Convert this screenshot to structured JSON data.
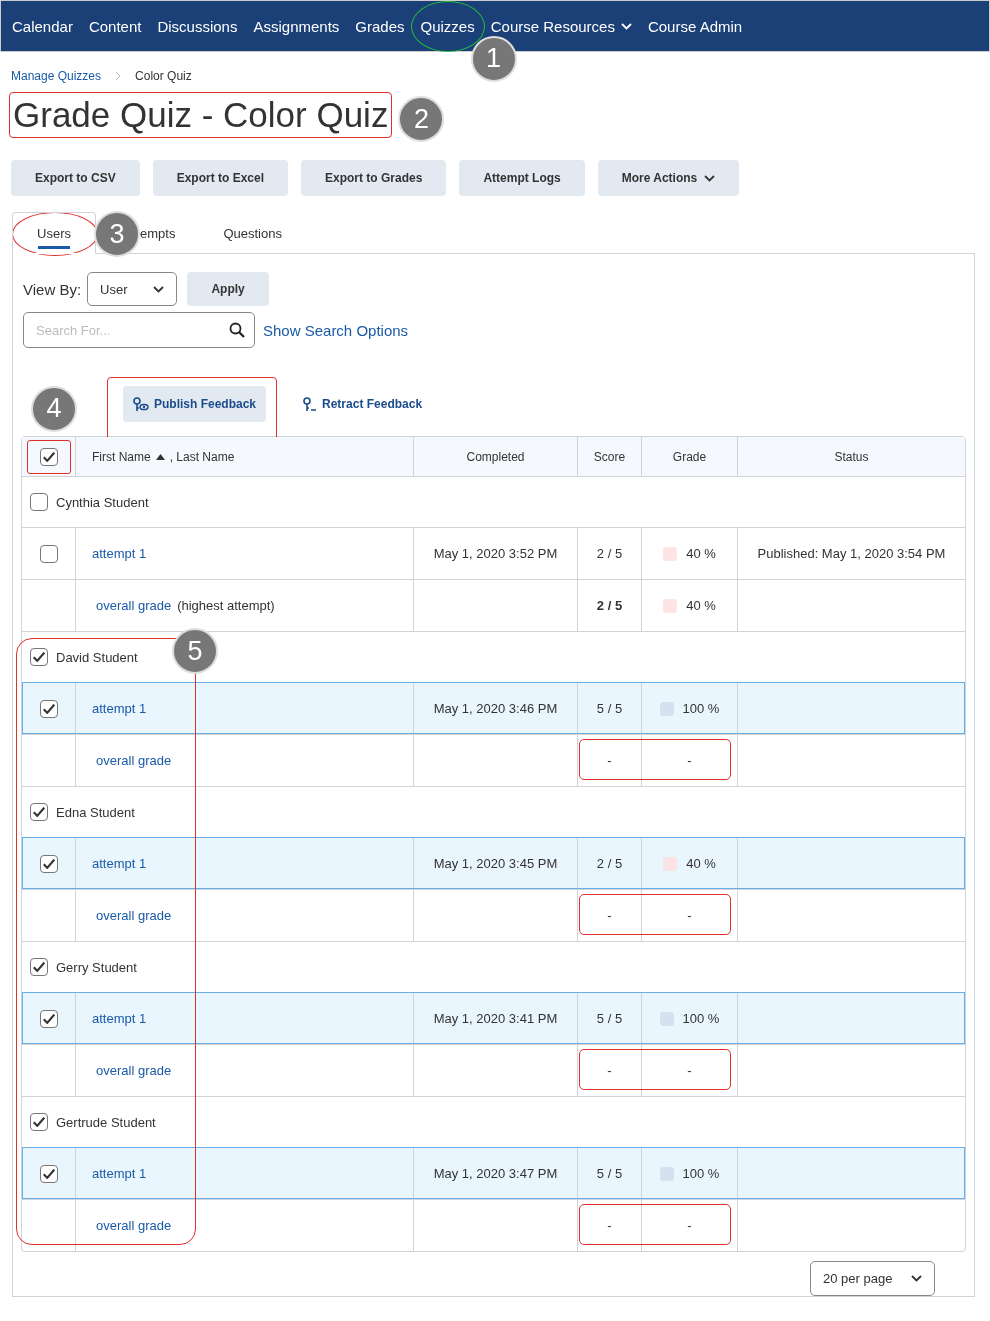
{
  "nav": [
    {
      "label": "Calendar",
      "dropdown": false,
      "circled": false
    },
    {
      "label": "Content",
      "dropdown": false,
      "circled": false
    },
    {
      "label": "Discussions",
      "dropdown": false,
      "circled": false
    },
    {
      "label": "Assignments",
      "dropdown": false,
      "circled": false
    },
    {
      "label": "Grades",
      "dropdown": false,
      "circled": false
    },
    {
      "label": "Quizzes",
      "dropdown": false,
      "circled": true,
      "callout": "1"
    },
    {
      "label": "Course Resources",
      "dropdown": true,
      "circled": false
    },
    {
      "label": "Course Admin",
      "dropdown": false,
      "circled": false
    }
  ],
  "breadcrumb": [
    {
      "label": "Manage Quizzes",
      "link": true
    },
    {
      "label": "Color Quiz",
      "link": false
    }
  ],
  "title": {
    "text": "Grade Quiz - Color Quiz",
    "outlined": true,
    "callout": "2"
  },
  "actions": [
    {
      "label": "Export to CSV",
      "dropdown": false
    },
    {
      "label": "Export to Excel",
      "dropdown": false
    },
    {
      "label": "Export to Grades",
      "dropdown": false
    },
    {
      "label": "Attempt Logs",
      "dropdown": false
    },
    {
      "label": "More Actions",
      "dropdown": true
    }
  ],
  "tabs": [
    {
      "label": "Users",
      "selected": true,
      "circled": true,
      "callout": "3"
    },
    {
      "label": "empts",
      "selected": false,
      "circled": false
    },
    {
      "label": "Questions",
      "selected": false,
      "circled": false
    }
  ],
  "view_by": {
    "label": "View By:",
    "value": "User",
    "button": "Apply"
  },
  "search": {
    "placeholder": "Search For...",
    "link": "Show Search Options"
  },
  "feedback": {
    "callout": "4",
    "buttons": [
      {
        "label": "Publish Feedback",
        "kind": "publish",
        "outlined": true
      },
      {
        "label": "Retract Feedback",
        "kind": "retract",
        "outlined": false
      }
    ]
  },
  "table": {
    "header_checkbox": {
      "checked": true,
      "outlined": true
    },
    "name_column": {
      "first": "First Name",
      "second": ", Last Name",
      "sort_ascending": true
    },
    "columns": [
      "Completed",
      "Score",
      "Grade",
      "Status"
    ],
    "students": [
      {
        "name": "Cynthia Student",
        "checked": false,
        "attempts": [
          {
            "label": "attempt 1",
            "checked": false,
            "selected": false,
            "completed": "May 1, 2020 3:52 PM",
            "score": "2 / 5",
            "grade": "40 %",
            "color": "#fde3e3",
            "status": "Published: May 1, 2020 3:54 PM"
          }
        ],
        "overall": {
          "label": "overall grade",
          "note": "(highest attempt)",
          "score": "2 / 5",
          "grade": "40 %",
          "color": "#fde3e3",
          "outlined": false
        }
      }
    ],
    "outlined_group": {
      "callout": "5",
      "students": [
        {
          "name": "David Student",
          "checked": true,
          "attempts": [
            {
              "label": "attempt 1",
              "checked": true,
              "selected": true,
              "completed": "May 1, 2020 3:46 PM",
              "score": "5 / 5",
              "grade": "100 %",
              "color": "#d6e0ee"
            }
          ],
          "overall": {
            "label": "overall grade",
            "score": "-",
            "grade": "-",
            "outlined": true
          }
        },
        {
          "name": "Edna Student",
          "checked": true,
          "attempts": [
            {
              "label": "attempt 1",
              "checked": true,
              "selected": true,
              "completed": "May 1, 2020 3:45 PM",
              "score": "2 / 5",
              "grade": "40 %",
              "color": "#fde3e3"
            }
          ],
          "overall": {
            "label": "overall grade",
            "score": "-",
            "grade": "-",
            "outlined": true
          }
        },
        {
          "name": "Gerry Student",
          "checked": true,
          "attempts": [
            {
              "label": "attempt 1",
              "checked": true,
              "selected": true,
              "completed": "May 1, 2020 3:41 PM",
              "score": "5 / 5",
              "grade": "100 %",
              "color": "#d6e0ee"
            }
          ],
          "overall": {
            "label": "overall grade",
            "score": "-",
            "grade": "-",
            "outlined": true
          }
        },
        {
          "name": "Gertrude Student",
          "checked": true,
          "attempts": [
            {
              "label": "attempt 1",
              "checked": true,
              "selected": true,
              "completed": "May 1, 2020 3:47 PM",
              "score": "5 / 5",
              "grade": "100 %",
              "color": "#d6e0ee"
            }
          ],
          "overall": {
            "label": "overall grade",
            "score": "-",
            "grade": "-",
            "outlined": true
          }
        }
      ]
    }
  },
  "pager": {
    "label": "20 per page"
  }
}
